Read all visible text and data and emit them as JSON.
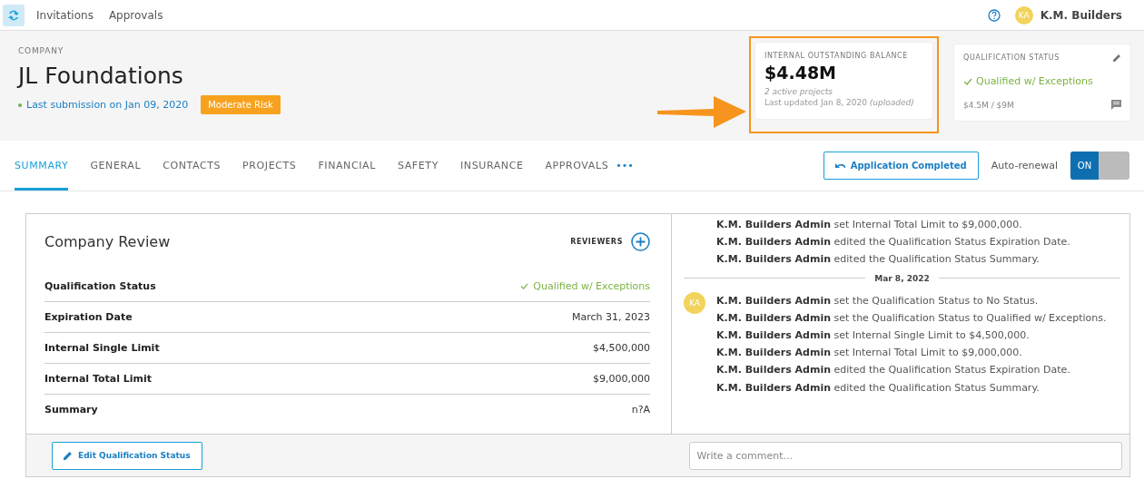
{
  "topbar": {
    "nav": [
      "Invitations",
      "Approvals"
    ],
    "user": {
      "initials": "KA",
      "name": "K.M. Builders"
    }
  },
  "company": {
    "eyebrow": "COMPANY",
    "name": "JL Foundations",
    "submission": "Last submission on Jan 09, 2020",
    "risk": "Moderate Risk"
  },
  "balance_card": {
    "title": "INTERNAL OUTSTANDING BALANCE",
    "value": "$4.48M",
    "projects": "2 active projects",
    "updated": "Last updated Jan 8, 2020 *(uploaded)*",
    "highlighted": true
  },
  "status_card": {
    "title": "QUALIFICATION STATUS",
    "status": "Qualified w/ Exceptions",
    "limits": "$4.5M / $9M"
  },
  "tabs": [
    {
      "label": "SUMMARY",
      "selected": true
    },
    {
      "label": "GENERAL",
      "selected": false
    },
    {
      "label": "CONTACTS",
      "selected": false
    },
    {
      "label": "PROJECTS",
      "selected": false
    },
    {
      "label": "FINANCIAL",
      "selected": false
    },
    {
      "label": "SAFETY",
      "selected": false
    },
    {
      "label": "INSURANCE",
      "selected": false
    },
    {
      "label": "APPROVALS",
      "selected": false
    }
  ],
  "tabs_more": "•••",
  "application_button": "Application Completed",
  "auto_renewal": {
    "label": "Auto-renewal",
    "text": "ON",
    "on": true
  },
  "review": {
    "title": "Company Review",
    "reviewers_label": "REVIEWERS",
    "rows": [
      {
        "label": "Qualification Status",
        "value": "Qualified w/ Exceptions",
        "kind": "status"
      },
      {
        "label": "Expiration Date",
        "value": "March 31, 2023",
        "kind": "text"
      },
      {
        "label": "Internal Single Limit",
        "value": "$4,500,000",
        "kind": "text"
      },
      {
        "label": "Internal Total Limit",
        "value": "$9,000,000",
        "kind": "text"
      },
      {
        "label": "Summary",
        "value": "n?A",
        "kind": "text"
      }
    ],
    "edit_button": "Edit Qualification Status"
  },
  "activity": [
    {
      "entries": [
        "**K.M. Builders Admin** set Internal Total Limit to $9,000,000.",
        "**K.M. Builders Admin** edited the Qualification Status Expiration Date.",
        "**K.M. Builders Admin** edited the Qualification Status Summary."
      ]
    },
    {
      "date": "Mar 8, 2022",
      "avatar": "KA",
      "entries": [
        "**K.M. Builders Admin** set the Qualification Status to No Status.",
        "**K.M. Builders Admin** set the Qualification Status to Qualified w/ Exceptions.",
        "**K.M. Builders Admin** set Internal Single Limit to $4,500,000.",
        "**K.M. Builders Admin** set Internal Total Limit to $9,000,000.",
        "**K.M. Builders Admin** edited the Qualification Status Expiration Date.",
        "**K.M. Builders Admin** edited the Qualification Status Summary."
      ]
    }
  ],
  "comment": {
    "placeholder": "Write a comment..."
  }
}
